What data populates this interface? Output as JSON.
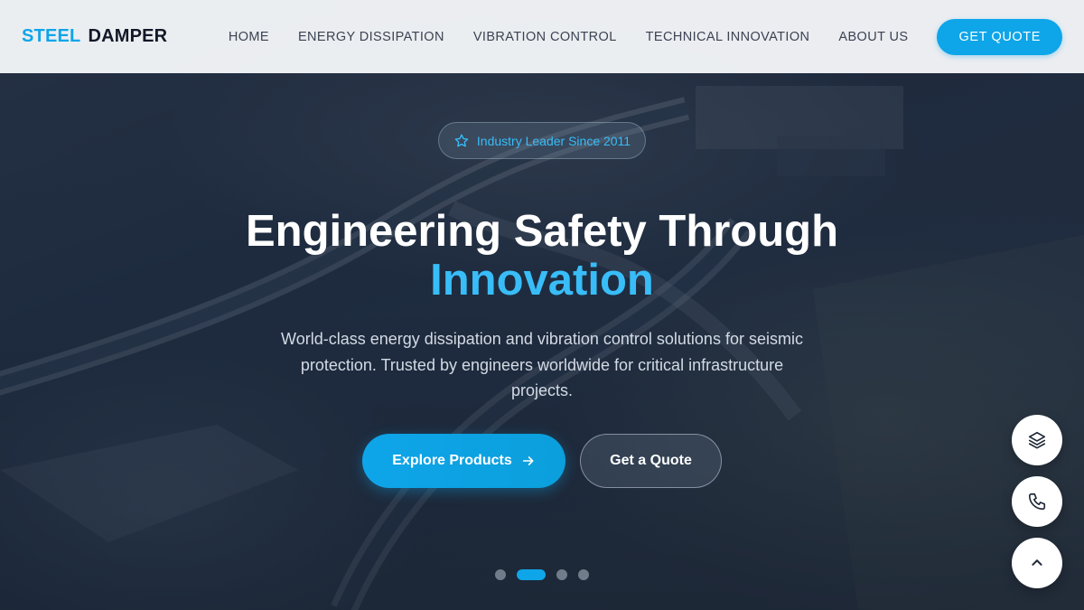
{
  "brand": {
    "part1": "STEEL",
    "part2": "DAMPER"
  },
  "nav": {
    "items": [
      {
        "label": "HOME"
      },
      {
        "label": "ENERGY DISSIPATION"
      },
      {
        "label": "VIBRATION CONTROL"
      },
      {
        "label": "TECHNICAL INNOVATION"
      },
      {
        "label": "ABOUT US"
      }
    ],
    "cta_label": "GET QUOTE"
  },
  "hero": {
    "badge_icon": "star-icon",
    "badge": "Industry Leader Since 2011",
    "title_line1": "Engineering Safety Through",
    "title_accent": "Innovation",
    "subtitle": "World-class energy dissipation and vibration control solutions for seismic protection. Trusted by engineers worldwide for critical infrastructure projects.",
    "primary_button": "Explore Products",
    "primary_button_icon": "arrow-right-icon",
    "secondary_button": "Get a Quote",
    "slides": {
      "count": 4,
      "active": 2
    }
  },
  "floating_actions": [
    {
      "icon": "layers-icon"
    },
    {
      "icon": "phone-icon"
    },
    {
      "icon": "chevron-up-icon"
    }
  ],
  "colors": {
    "accent": "#0ea5e9",
    "accent_light": "#38bdf8",
    "nav_text": "#3b4352",
    "header_bg": "#f4f6f9"
  }
}
